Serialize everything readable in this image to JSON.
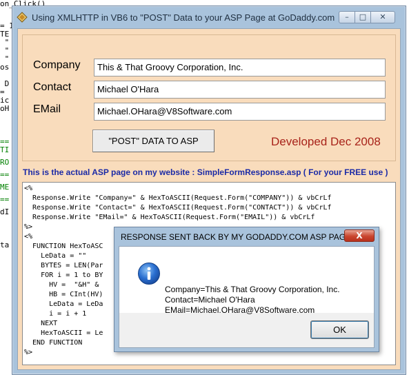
{
  "background": {
    "top_line": "on_Click()",
    "code_lines": [
      {
        "text": "= 1",
        "color": "black"
      },
      {
        "text": "TE",
        "color": "black"
      },
      {
        "text": " \"",
        "color": "black"
      },
      {
        "text": " \"",
        "color": "black"
      },
      {
        "text": " \"",
        "color": "black"
      },
      {
        "text": "os",
        "color": "black"
      },
      {
        "text": " D",
        "color": "black"
      },
      {
        "text": "=",
        "color": "black"
      },
      {
        "text": "ic",
        "color": "black"
      },
      {
        "text": "oH",
        "color": "black"
      },
      {
        "text": "==",
        "color": "green"
      },
      {
        "text": "TI",
        "color": "green"
      },
      {
        "text": "RO",
        "color": "green"
      },
      {
        "text": "==",
        "color": "green"
      },
      {
        "text": "ME",
        "color": "green"
      },
      {
        "text": "==",
        "color": "green"
      },
      {
        "text": "dI",
        "color": "black"
      },
      {
        "text": "ta",
        "color": "black"
      }
    ]
  },
  "window": {
    "title": "Using XMLHTTP in VB6 to \"POST\" Data to your ASP Page at GoDaddy.com",
    "icon": "diamond-app-icon",
    "controls": {
      "minimize": "–",
      "maximize": "□",
      "close": "✕"
    }
  },
  "form": {
    "company_label": "Company",
    "company_value": "This & That Groovy Corporation, Inc.",
    "contact_label": "Contact",
    "contact_value": "Michael O'Hara",
    "email_label": "EMail",
    "email_value": "Michael.OHara@V8Software.com",
    "post_button_label": "\"POST\" DATA TO ASP",
    "developed_label": "Developed Dec 2008"
  },
  "asp_info": "This is the actual ASP page on my website : SimpleFormResponse.asp  ( For your FREE use )",
  "code_lines": [
    "<%",
    "  Response.Write \"Company=\" & HexToASCII(Request.Form(\"COMPANY\")) & vbCrLf",
    "  Response.Write \"Contact=\" & HexToASCII(Request.Form(\"CONTACT\")) & vbCrLf",
    "  Response.Write \"EMail=\" & HexToASCII(Request.Form(\"EMAIL\")) & vbCrLf",
    "%>",
    "<%",
    "  FUNCTION HexToASC",
    "    LeData = \"\"",
    "    BYTES = LEN(Par",
    "    FOR i = 1 to BY",
    "      HV =  \"&H\" &",
    "      HB = CInt(HV)",
    "      LeData = LeDa",
    "      i = i + 1",
    "    NEXT",
    "    HexToASCII = Le",
    "  END FUNCTION",
    "%>"
  ],
  "message_box": {
    "title": "RESPONSE SENT BACK BY MY GODADDY.COM ASP PAGE!",
    "close_glyph": "X",
    "icon": "info-icon",
    "lines": [
      "Company=This & That Groovy Corporation, Inc.",
      "Contact=Michael O'Hara",
      "EMail=Michael.OHara@V8Software.com"
    ],
    "ok_label": "OK"
  }
}
